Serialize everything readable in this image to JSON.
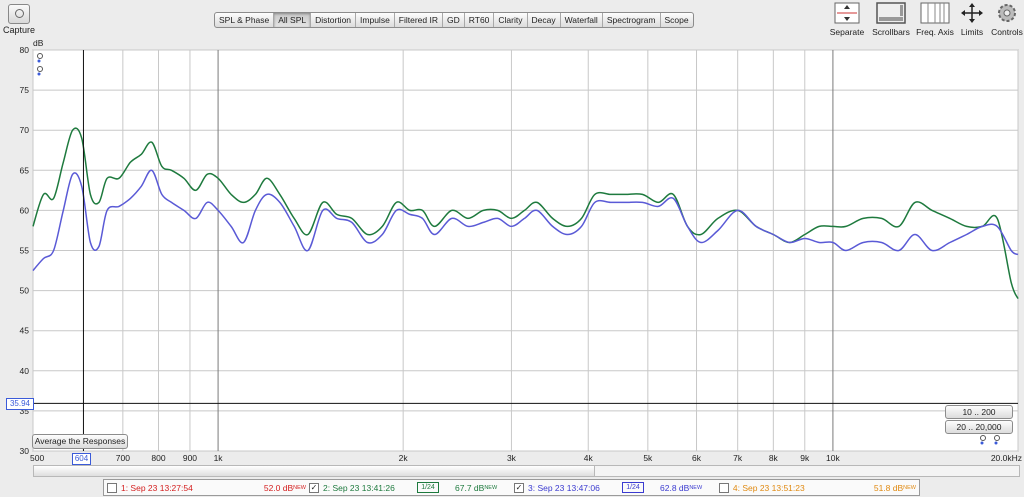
{
  "toolbar": {
    "capture_label": "Capture",
    "tabs": [
      "SPL & Phase",
      "All SPL",
      "Distortion",
      "Impulse",
      "Filtered IR",
      "GD",
      "RT60",
      "Clarity",
      "Decay",
      "Waterfall",
      "Spectrogram",
      "Scope"
    ],
    "active_tab": "All SPL",
    "right_buttons": [
      "Separate",
      "Scrollbars",
      "Freq. Axis",
      "Limits",
      "Controls"
    ]
  },
  "chart_data": {
    "type": "line",
    "y_unit": "dB",
    "ylim": [
      30,
      80
    ],
    "yticks": [
      80,
      75,
      70,
      65,
      60,
      55,
      50,
      45,
      40,
      35,
      30
    ],
    "xscale": "log",
    "xlim": [
      500,
      20000
    ],
    "xtick_labels": [
      "500",
      "700",
      "800",
      "900",
      "1k",
      "2k",
      "3k",
      "4k",
      "5k",
      "6k",
      "7k",
      "8k",
      "9k",
      "10k",
      "20.0kHz"
    ],
    "xtick_values": [
      500,
      700,
      800,
      900,
      1000,
      2000,
      3000,
      4000,
      5000,
      6000,
      7000,
      8000,
      9000,
      10000,
      20000
    ],
    "grid": true,
    "cursor": {
      "x_label": "604",
      "x": 604,
      "y_label": "35.94",
      "y": 35.94
    },
    "series": [
      {
        "name": "2: Sep 23 13:41:26",
        "color": "#1e7a3e",
        "x": [
          500,
          520,
          540,
          560,
          580,
          600,
          620,
          640,
          660,
          690,
          720,
          750,
          780,
          810,
          840,
          880,
          920,
          960,
          1000,
          1050,
          1100,
          1150,
          1200,
          1260,
          1330,
          1400,
          1480,
          1560,
          1650,
          1750,
          1850,
          1950,
          2050,
          2150,
          2250,
          2400,
          2550,
          2700,
          2850,
          3000,
          3150,
          3300,
          3500,
          3700,
          3900,
          4100,
          4350,
          4600,
          4900,
          5200,
          5500,
          5800,
          6100,
          6500,
          7000,
          7500,
          8000,
          8500,
          9000,
          9500,
          10000,
          10500,
          11200,
          12000,
          12800,
          13600,
          14500,
          15500,
          16500,
          17500,
          18500,
          19500,
          20000
        ],
        "y": [
          58,
          62,
          61.5,
          66,
          70,
          69,
          62,
          61,
          64,
          64,
          66,
          67,
          68.5,
          65.5,
          65,
          64,
          62.5,
          64.5,
          64,
          62,
          61,
          62,
          64,
          62,
          59,
          57,
          61,
          59.5,
          59,
          57,
          58,
          61,
          60,
          60,
          58,
          60,
          59,
          60,
          60,
          59,
          60,
          61,
          59,
          58,
          59,
          62,
          62,
          62,
          62,
          61,
          62,
          58,
          57,
          59,
          60,
          58,
          57,
          56,
          57,
          58,
          58,
          58,
          59,
          59,
          58,
          61,
          60,
          59,
          58,
          58,
          59,
          51,
          49
        ]
      },
      {
        "name": "3: Sep 23 13:47:06",
        "color": "#5a5ad6",
        "x": [
          500,
          520,
          540,
          560,
          580,
          600,
          620,
          640,
          660,
          690,
          720,
          750,
          780,
          810,
          840,
          880,
          920,
          960,
          1000,
          1050,
          1100,
          1150,
          1200,
          1260,
          1330,
          1400,
          1480,
          1560,
          1650,
          1750,
          1850,
          1950,
          2050,
          2150,
          2250,
          2400,
          2550,
          2700,
          2850,
          3000,
          3150,
          3300,
          3500,
          3700,
          3900,
          4100,
          4350,
          4600,
          4900,
          5200,
          5500,
          5800,
          6100,
          6500,
          7000,
          7500,
          8000,
          8500,
          9000,
          9500,
          10000,
          10500,
          11200,
          12000,
          12800,
          13600,
          14500,
          15500,
          16500,
          17500,
          18500,
          19500,
          20000
        ],
        "y": [
          52.5,
          54,
          55,
          60,
          64.5,
          63,
          56,
          55.5,
          60,
          60.5,
          61.5,
          63,
          65,
          62,
          61,
          60,
          59,
          61,
          60,
          58,
          56,
          60,
          62,
          61,
          58,
          55,
          60,
          59,
          58.5,
          56,
          57,
          60,
          59.5,
          59,
          57,
          59,
          58,
          58.5,
          59,
          58,
          59,
          60,
          58,
          57,
          58,
          61,
          61,
          61,
          61,
          60.5,
          61.5,
          58,
          56,
          57.5,
          60,
          58,
          57,
          56,
          56.5,
          56,
          56,
          55,
          56,
          56,
          55,
          57,
          55,
          56,
          57,
          58,
          58,
          55,
          54.5
        ]
      }
    ]
  },
  "controls": {
    "average_button": "Average the Responses",
    "range_buttons": [
      "10 .. 200",
      "20 .. 20,000"
    ]
  },
  "legend": [
    {
      "label": "1: Sep 23 13:27:54",
      "checked": false,
      "level": "52.0 dB",
      "tag": "NEW",
      "color": "#d42020",
      "box": ""
    },
    {
      "label": "2: Sep 23 13:41:26",
      "checked": true,
      "level": "67.7 dB",
      "tag": "NEW",
      "color": "#1e7a3e",
      "box": "1/24"
    },
    {
      "label": "3: Sep 23 13:47:06",
      "checked": true,
      "level": "62.8 dB",
      "tag": "NEW",
      "color": "#3b3bd0",
      "box": "1/24"
    },
    {
      "label": "4: Sep 23 13:51:23",
      "checked": false,
      "level": "51.8 dB",
      "tag": "NEW",
      "color": "#e08a12",
      "box": ""
    }
  ]
}
